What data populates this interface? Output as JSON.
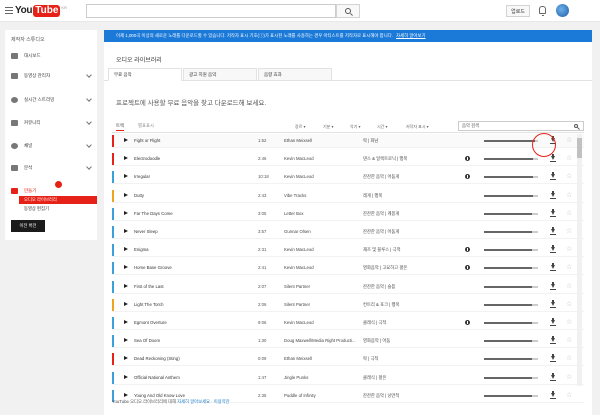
{
  "masthead": {
    "logo_you": "You",
    "logo_tube": "Tube",
    "logo_region": "KR",
    "upload_label": "업로드"
  },
  "sidebar": {
    "heading": "제작자 스튜디오",
    "items": [
      {
        "label": "대시보드"
      },
      {
        "label": "동영상 관리자"
      },
      {
        "label": "실시간 스트리밍"
      },
      {
        "label": "커뮤니티"
      },
      {
        "label": "채널"
      },
      {
        "label": "분석"
      },
      {
        "label": "만들기"
      }
    ],
    "subitems": [
      {
        "label": "오디오 라이브러리"
      },
      {
        "label": "동영상 편집기"
      }
    ],
    "studio_button": "이전 버전"
  },
  "notice": {
    "text": "이제 1,000곡 이상의 새로운 노래를 다운로드할 수 있습니다. 저작자 표시 기호(ⓘ)가 표시된 노래를 사용하는 경우 아티스트를 저작자로 표시해야 합니다.",
    "link": "자세히 알아보기"
  },
  "page_title": "오디오 라이브러리",
  "tabs": [
    {
      "label": "무료 음악"
    },
    {
      "label": "광고 지원 음악"
    },
    {
      "label": "음향 효과"
    }
  ],
  "intro": "프로젝트에 사용할 무료 음악을 찾고 다운로드해 보세요.",
  "filters": {
    "tab_all": "트랙",
    "tab_fav": "별표표시",
    "dropdowns": [
      "장르 ▾",
      "기분 ▾",
      "악기 ▾",
      "시간 ▾",
      "저작자 표시 ▾"
    ],
    "search_placeholder": "음악 검색"
  },
  "tracks": [
    {
      "title": "Fight or Flight",
      "duration": "1:52",
      "artist": "Ethan Meixsell",
      "genre": "락 | 화남",
      "attribution": false,
      "popularity": 0.95,
      "bar_color": "#e62117"
    },
    {
      "title": "Electrodoodle",
      "duration": "2:46",
      "artist": "Kevin MacLeod",
      "genre": "댄스 & 일렉트로닉 | 행복",
      "attribution": true,
      "popularity": 0.9,
      "bar_color": "#e62117"
    },
    {
      "title": "Irregular",
      "duration": "10:18",
      "artist": "Kevin MacLeod",
      "genre": "잔잔한 음악 | 어둠게",
      "attribution": true,
      "popularity": 0.9,
      "bar_color": "#3b9fd9"
    },
    {
      "title": "Dutty",
      "duration": "2:43",
      "artist": "Vibe Tracks",
      "genre": "레게 | 행복",
      "attribution": false,
      "popularity": 0.9,
      "bar_color": "#f0a31d"
    },
    {
      "title": "Far The Days Come",
      "duration": "3:05",
      "artist": "Letter Box",
      "genre": "잔잔한 음악 | 계몽게",
      "attribution": false,
      "popularity": 0.88,
      "bar_color": "#3b9fd9"
    },
    {
      "title": "Never Sleep",
      "duration": "3:57",
      "artist": "Gunnar Olsen",
      "genre": "잔잔한 음악 | 어둠게",
      "attribution": false,
      "popularity": 0.88,
      "bar_color": "#3b9fd9"
    },
    {
      "title": "Enigma",
      "duration": "2:31",
      "artist": "Kevin MacLeod",
      "genre": "재즈 및 블루스 | 극적",
      "attribution": true,
      "popularity": 0.88,
      "bar_color": "#3b9fd9"
    },
    {
      "title": "Home Base Groove",
      "duration": "2:41",
      "artist": "Kevin MacLeod",
      "genre": "영화음악 | 고요하고 평온",
      "attribution": true,
      "popularity": 0.88,
      "bar_color": "#3b9fd9"
    },
    {
      "title": "First of the Last",
      "duration": "2:07",
      "artist": "Silent Partner",
      "genre": "잔잔한 음악 | 슬픔",
      "attribution": false,
      "popularity": 0.88,
      "bar_color": "#3b9fd9"
    },
    {
      "title": "Light The Torch",
      "duration": "2:06",
      "artist": "Silent Partner",
      "genre": "컨트리 & 포크 | 행복",
      "attribution": false,
      "popularity": 0.88,
      "bar_color": "#f0a31d"
    },
    {
      "title": "Egmont Overture",
      "duration": "9:06",
      "artist": "Kevin MacLeod",
      "genre": "클래식 | 극적",
      "attribution": true,
      "popularity": 0.88,
      "bar_color": "#3b9fd9"
    },
    {
      "title": "Sea Of Doom",
      "duration": "1:30",
      "artist": "Doug Maxwell/Media Right Producti...",
      "genre": "영화음악 | 어둠",
      "attribution": false,
      "popularity": 0.88,
      "bar_color": "#3b9fd9"
    },
    {
      "title": "Dead Reckoning (Sting)",
      "duration": "0:09",
      "artist": "Ethan Meixsell",
      "genre": "락 | 극적",
      "attribution": false,
      "popularity": 0.88,
      "bar_color": "#e62117"
    },
    {
      "title": "Official National Anthem",
      "duration": "1:47",
      "artist": "Jingle Punks",
      "genre": "클래식 | 평온",
      "attribution": false,
      "popularity": 0.88,
      "bar_color": "#3b9fd9"
    },
    {
      "title": "Young And Old Know Love",
      "duration": "2:35",
      "artist": "Puddle of Infinity",
      "genre": "잔잔한 음악 | 낭만적",
      "attribution": false,
      "popularity": 0.88,
      "bar_color": "#3b9fd9"
    }
  ],
  "footer": {
    "text": "YouTube 오디오 라이브러리에 대해",
    "link": "자세히 알아보세요 · 이용약관"
  },
  "colors": {
    "brand_red": "#e62117",
    "notice_blue": "#1b79d8"
  }
}
